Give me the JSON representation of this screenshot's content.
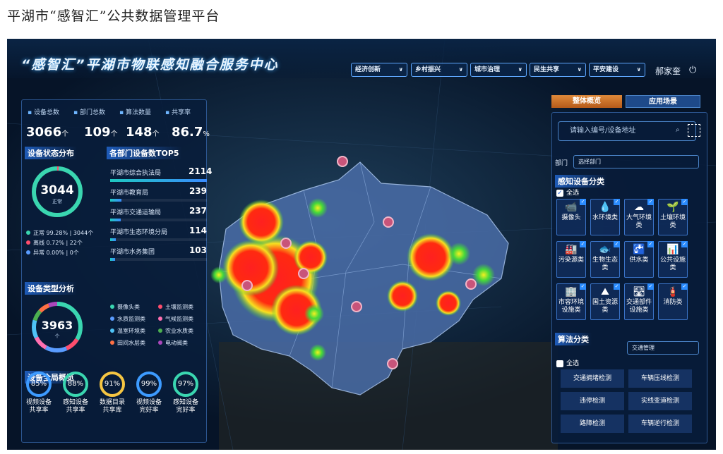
{
  "caption": "平湖市“感智汇”公共数据管理平台",
  "header": {
    "title": "“感智汇”平湖市物联感知融合服务中心",
    "nav": [
      "经济创新",
      "乡村振兴",
      "城市治理",
      "民生共享",
      "平安建设"
    ],
    "user": "郝家奎"
  },
  "stats": [
    {
      "label": "设备总数",
      "value": "3066",
      "unit": "个"
    },
    {
      "label": "部门总数",
      "value": "109",
      "unit": "个"
    },
    {
      "label": "算法数量",
      "value": "148",
      "unit": "个"
    },
    {
      "label": "共享率",
      "value": "86.7",
      "unit": "%"
    }
  ],
  "status": {
    "title": "设备状态分布",
    "total": "3044",
    "sub": "正常",
    "items": [
      {
        "name": "正常",
        "text": "99.28% | 3044个",
        "color": "#3ad6b0"
      },
      {
        "name": "离线",
        "text": "0.72% | 22个",
        "color": "#ff4d6d"
      },
      {
        "name": "异常",
        "text": "0.00% | 0个",
        "color": "#5a9cff"
      }
    ]
  },
  "top5": {
    "title": "各部门设备数TOP5",
    "items": [
      {
        "name": "平湖市综合执法局",
        "value": 2114
      },
      {
        "name": "平湖市教育局",
        "value": 239
      },
      {
        "name": "平湖市交通运输局",
        "value": 237
      },
      {
        "name": "平湖市生态环境分局",
        "value": 114
      },
      {
        "name": "平湖市水务集团",
        "value": 103
      }
    ]
  },
  "types": {
    "title": "设备类型分析",
    "total": "3963",
    "sub": "个",
    "items": [
      {
        "name": "摄像头类",
        "color": "#3ad6b0"
      },
      {
        "name": "土壤监测类",
        "color": "#ff4d6d"
      },
      {
        "name": "水质监测类",
        "color": "#5a9cff"
      },
      {
        "name": "气候监测类",
        "color": "#ff6fb0"
      },
      {
        "name": "温室环境类",
        "color": "#4fc3f7"
      },
      {
        "name": "农业水质类",
        "color": "#4caf50"
      },
      {
        "name": "田间水层类",
        "color": "#ff7043"
      },
      {
        "name": "电动阀类",
        "color": "#ab47bc"
      }
    ]
  },
  "overview": {
    "title": "设备全局概览",
    "items": [
      {
        "value": "85%",
        "label1": "视频设备",
        "label2": "共享率",
        "color": "#3d9bff"
      },
      {
        "value": "88%",
        "label1": "感知设备",
        "label2": "共享率",
        "color": "#3ad6b0"
      },
      {
        "value": "91%",
        "label1": "数据目录",
        "label2": "共享库",
        "color": "#f5c542"
      },
      {
        "value": "99%",
        "label1": "视频设备",
        "label2": "完好率",
        "color": "#3d9bff"
      },
      {
        "value": "97%",
        "label1": "感知设备",
        "label2": "完好率",
        "color": "#3ad6b0"
      }
    ]
  },
  "right": {
    "tabs": [
      "整体概览",
      "应用场景"
    ],
    "search_placeholder": "请输入编号/设备地址",
    "dept_label": "部门",
    "dept_select": "选择部门",
    "sense_title": "感知设备分类",
    "select_all": "全选",
    "tiles": [
      {
        "icon": "📹",
        "l1": "摄像头",
        "l2": ""
      },
      {
        "icon": "💧",
        "l1": "水环境类",
        "l2": ""
      },
      {
        "icon": "☁",
        "l1": "大气环境",
        "l2": "类"
      },
      {
        "icon": "🌱",
        "l1": "土壤环境",
        "l2": "类"
      },
      {
        "icon": "🏭",
        "l1": "污染源类",
        "l2": ""
      },
      {
        "icon": "🐟",
        "l1": "生物生态",
        "l2": "类"
      },
      {
        "icon": "🚰",
        "l1": "供水类",
        "l2": ""
      },
      {
        "icon": "📊",
        "l1": "公共设施",
        "l2": "类"
      },
      {
        "icon": "🏢",
        "l1": "市容环境",
        "l2": "设施类"
      },
      {
        "icon": "⛰",
        "l1": "国土资源",
        "l2": "类"
      },
      {
        "icon": "🛣",
        "l1": "交通部件",
        "l2": "设施类"
      },
      {
        "icon": "🧯",
        "l1": "消防类",
        "l2": ""
      }
    ],
    "alg_title": "算法分类",
    "alg_select": "交通管理",
    "alg_all": "全选",
    "algs": [
      "交通拥堵检测",
      "车辆压线检测",
      "违停检测",
      "实线变道检测",
      "路障检测",
      "车辆逆行检测"
    ]
  }
}
